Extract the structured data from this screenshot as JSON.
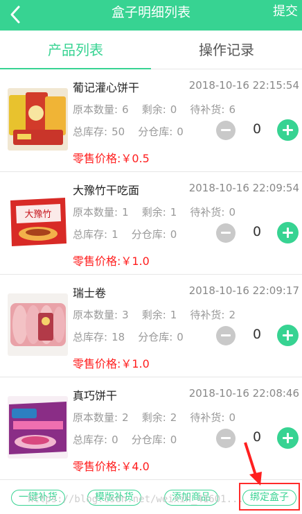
{
  "header": {
    "title": "盒子明细列表",
    "submit_label": "提交",
    "back_icon": "chevron-left-icon"
  },
  "tabs": [
    {
      "label": "产品列表",
      "active": true
    },
    {
      "label": "操作记录",
      "active": false
    }
  ],
  "labels": {
    "original_qty": "原本数量:",
    "remaining": "剩余:",
    "to_restock": "待补货:",
    "total_stock": "总库存:",
    "sub_warehouse": "分仓库:",
    "retail_price": "零售价格:"
  },
  "products": [
    {
      "name": "葡记灌心饼干",
      "time": "2018-10-16 22:15:54",
      "original_qty": "6",
      "remaining": "0",
      "to_restock": "6",
      "total_stock": "50",
      "sub_warehouse": "0",
      "qty": "0",
      "price": "￥0.5"
    },
    {
      "name": "大豫竹干吃面",
      "time": "2018-10-16 22:09:54",
      "original_qty": "1",
      "remaining": "1",
      "to_restock": "0",
      "total_stock": "1",
      "sub_warehouse": "0",
      "qty": "0",
      "price": "￥1.0"
    },
    {
      "name": "瑞士卷",
      "time": "2018-10-16 22:09:17",
      "original_qty": "3",
      "remaining": "1",
      "to_restock": "2",
      "total_stock": "18",
      "sub_warehouse": "0",
      "qty": "0",
      "price": "￥1.0"
    },
    {
      "name": "真巧饼干",
      "time": "2018-10-16 22:08:46",
      "original_qty": "2",
      "remaining": "2",
      "to_restock": "0",
      "total_stock": "0",
      "sub_warehouse": "0",
      "qty": "0",
      "price": "￥4.0"
    }
  ],
  "bottom_bar": {
    "buttons": [
      "一键补货",
      "模版补货",
      "添加商品",
      "绑定盒子"
    ],
    "watermark": "https://blog.csdn.net/weixin_41601..."
  },
  "colors": {
    "accent": "#37d392",
    "price": "#ff1d1d",
    "highlight": "#ff2a2a"
  }
}
